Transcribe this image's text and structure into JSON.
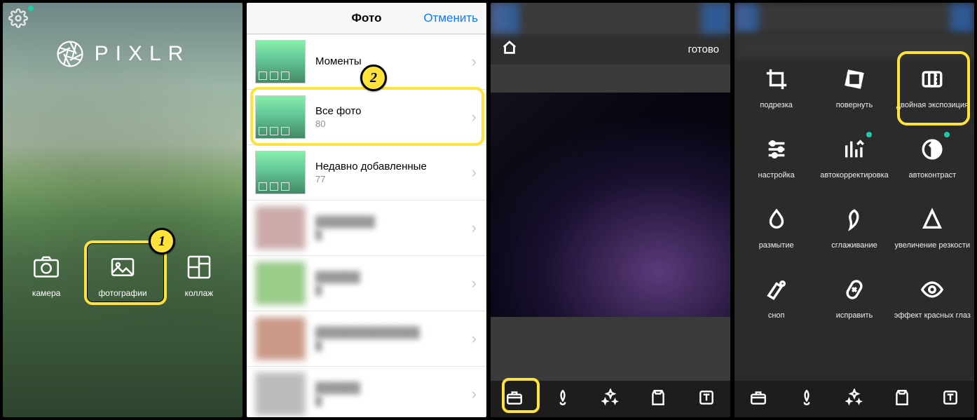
{
  "panel1": {
    "logo_text": "PIXLR",
    "actions": {
      "camera": "камера",
      "photos": "фотографии",
      "collage": "коллаж"
    },
    "badge": "1"
  },
  "panel2": {
    "nav_title": "Фото",
    "cancel": "Отменить",
    "badge": "2",
    "albums": [
      {
        "title": "Моменты",
        "count": ""
      },
      {
        "title": "Все фото",
        "count": "80"
      },
      {
        "title": "Недавно добавленные",
        "count": "77"
      }
    ]
  },
  "panel3": {
    "done": "готово"
  },
  "panel4": {
    "tools": [
      {
        "name": "подрезка"
      },
      {
        "name": "повернуть"
      },
      {
        "name": "двойная экспозиция"
      },
      {
        "name": "настройка"
      },
      {
        "name": "автокорректировка"
      },
      {
        "name": "автоконтраст"
      },
      {
        "name": "размытие"
      },
      {
        "name": "сглаживание"
      },
      {
        "name": "увеличение резкости"
      },
      {
        "name": "сноп"
      },
      {
        "name": "исправить"
      },
      {
        "name": "эффект красных глаз"
      }
    ]
  }
}
